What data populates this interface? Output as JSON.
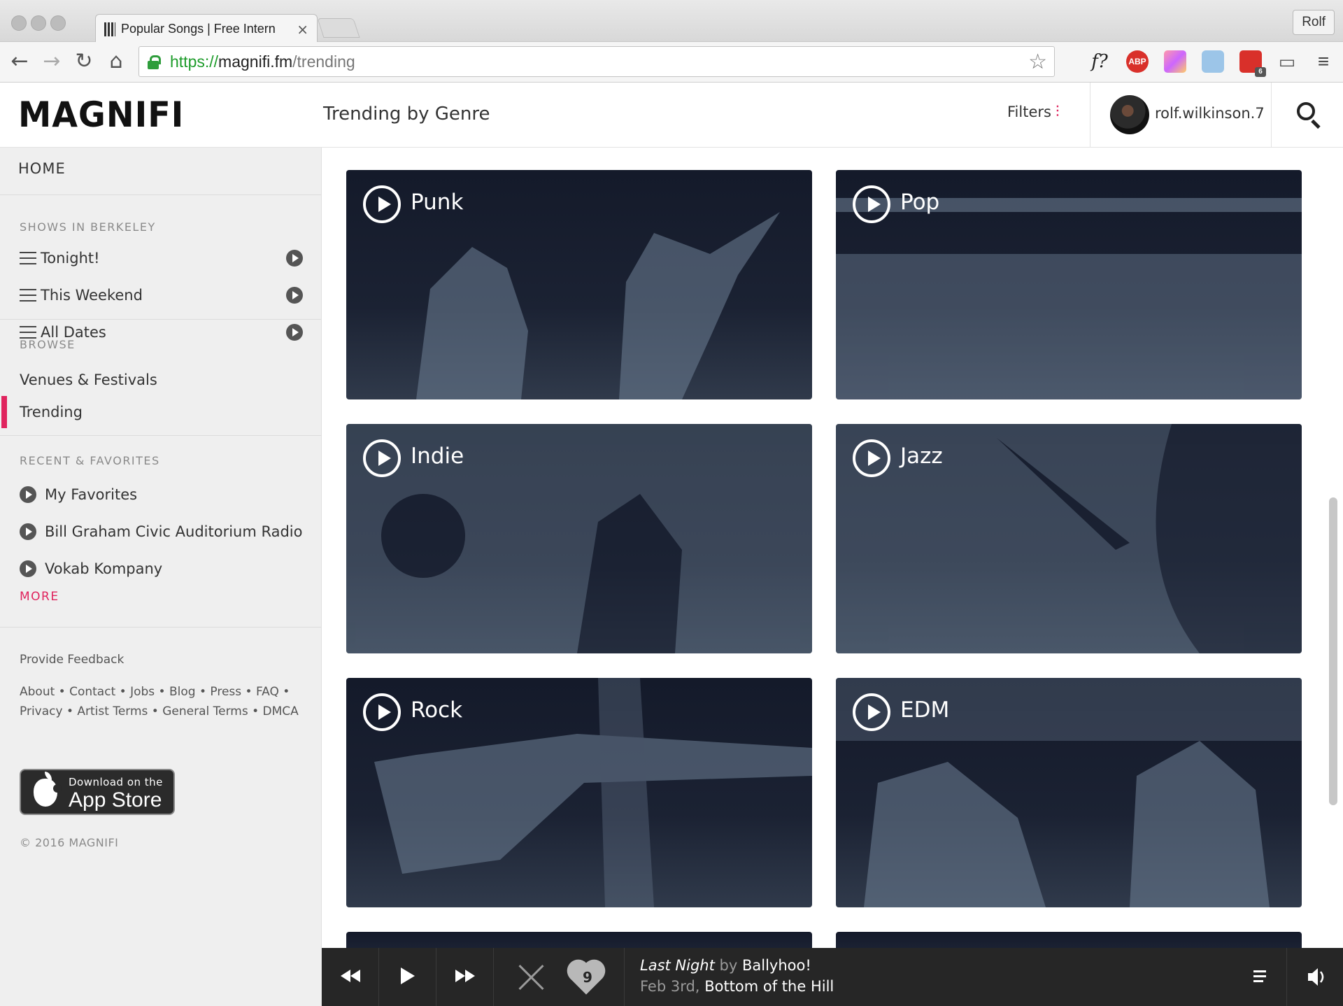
{
  "browser": {
    "tab_title": "Popular Songs | Free Intern",
    "tab_close": "×",
    "profile_name": "Rolf",
    "url_scheme": "https://",
    "url_host": "magnifi.fm",
    "url_path": "/trending",
    "extensions": [
      "f?",
      "ABP"
    ],
    "extension_badge": "6"
  },
  "header": {
    "logo": "MAGNIFI",
    "page_title": "Trending by Genre",
    "filters_label": "Filters",
    "username": "rolf.wilkinson.7"
  },
  "sidebar": {
    "home": "HOME",
    "shows_heading": "SHOWS IN BERKELEY",
    "shows": [
      {
        "label": "Tonight!"
      },
      {
        "label": "This Weekend"
      },
      {
        "label": "All Dates"
      }
    ],
    "browse_heading": "BROWSE",
    "browse": [
      {
        "label": "Venues & Festivals"
      },
      {
        "label": "Trending"
      }
    ],
    "recent_heading": "RECENT & FAVORITES",
    "recent": [
      {
        "label": "My Favorites"
      },
      {
        "label": "Bill Graham Civic Auditorium Radio"
      },
      {
        "label": "Vokab Kompany"
      }
    ],
    "more": "MORE",
    "feedback": "Provide Feedback",
    "links_line1": "About • Contact • Jobs • Blog • Press • FAQ •",
    "links_line2": "Privacy • Artist Terms • General Terms • DMCA",
    "appstore_small": "Download on the",
    "appstore_big": "App Store",
    "copyright": "© 2016 MAGNIFI"
  },
  "genres": [
    {
      "name": "Punk"
    },
    {
      "name": "Pop"
    },
    {
      "name": "Indie"
    },
    {
      "name": "Jazz"
    },
    {
      "name": "Rock"
    },
    {
      "name": "EDM"
    }
  ],
  "player": {
    "track": "Last Night",
    "by": "by",
    "artist": "Ballyhoo!",
    "date": "Feb 3rd,",
    "venue": "Bottom of the Hill",
    "likes": "9"
  },
  "colors": {
    "accent": "#e0245e",
    "player_bg": "#262626",
    "card_bg": "#1b2233"
  }
}
